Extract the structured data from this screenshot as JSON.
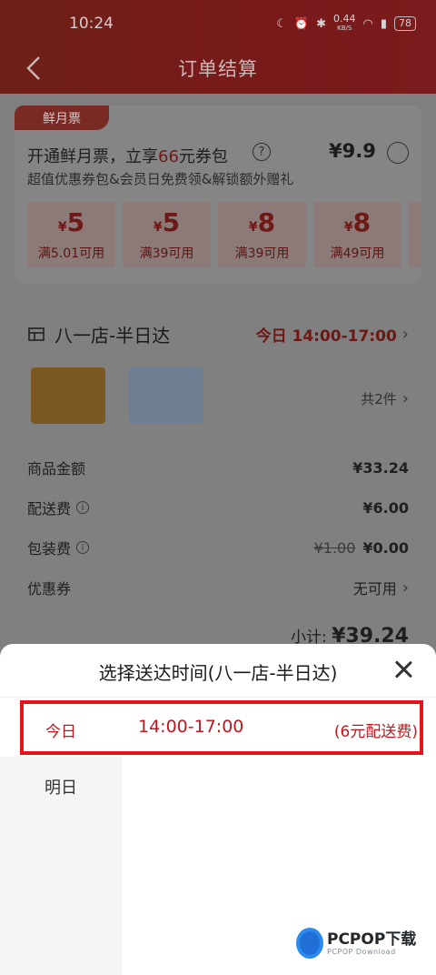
{
  "status_bar": {
    "time": "10:24",
    "net_speed": "0.44",
    "net_unit": "KB/S",
    "battery": "78"
  },
  "nav": {
    "title": "订单结算"
  },
  "membership": {
    "tag": "鲜月票",
    "title_prefix": "开通鲜月票，立享",
    "title_highlight": "66",
    "title_suffix": "元券包",
    "price": "¥9.9",
    "subtitle": "超值优惠券包&会员日免费领&解锁额外赠礼",
    "coupons": [
      {
        "symbol": "¥",
        "amount": "5",
        "condition": "满5.01可用"
      },
      {
        "symbol": "¥",
        "amount": "5",
        "condition": "满39可用"
      },
      {
        "symbol": "¥",
        "amount": "8",
        "condition": "满39可用"
      },
      {
        "symbol": "¥",
        "amount": "8",
        "condition": "满49可用"
      }
    ]
  },
  "order": {
    "store": "八一店-半日达",
    "delivery_time": "今日 14:00-17:00",
    "item_count": "共2件",
    "rows": {
      "goods_label": "商品金额",
      "goods_value": "¥33.24",
      "delivery_label": "配送费",
      "delivery_value": "¥6.00",
      "packing_label": "包装费",
      "packing_old": "¥1.00",
      "packing_value": "¥0.00",
      "coupon_label": "优惠券",
      "coupon_value": "无可用"
    },
    "subtotal_label": "小计:",
    "subtotal_value": "¥39.24"
  },
  "sheet": {
    "title": "选择送达时间(八一店-半日达)",
    "selected_day": "今日",
    "selected_slot": "14:00-17:00",
    "selected_fee": "(6元配送费)",
    "other_day": "明日"
  },
  "watermark": {
    "brand": "PCPOP下载",
    "sub": "PCPOP Download"
  },
  "colors": {
    "accent": "#e8141b",
    "selected_text": "#c0171f"
  }
}
